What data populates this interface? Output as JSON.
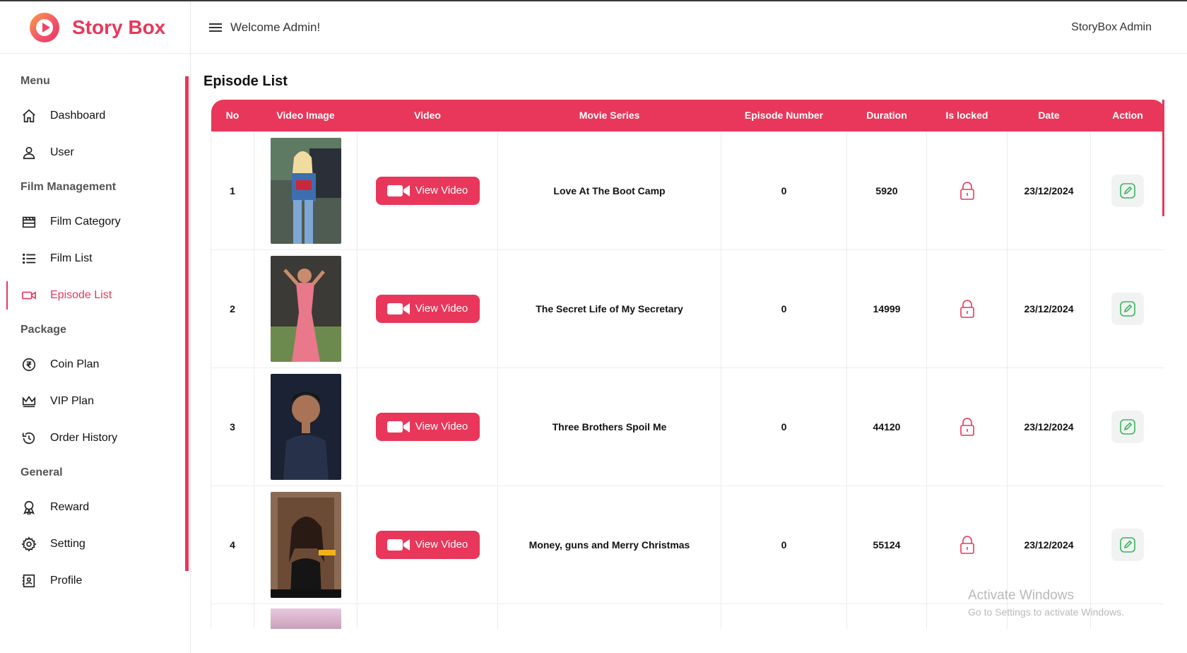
{
  "brand": {
    "name": "Story Box",
    "accent": "#e8375a"
  },
  "header": {
    "welcome": "Welcome Admin!",
    "user": "StoryBox Admin"
  },
  "sidebar": {
    "sections": [
      {
        "title": "Menu",
        "items": [
          {
            "label": "Dashboard",
            "icon": "home-icon"
          },
          {
            "label": "User",
            "icon": "user-icon"
          }
        ]
      },
      {
        "title": "Film Management",
        "items": [
          {
            "label": "Film Category",
            "icon": "clapperboard-icon"
          },
          {
            "label": "Film List",
            "icon": "list-icon"
          },
          {
            "label": "Episode List",
            "icon": "video-icon",
            "active": true
          }
        ]
      },
      {
        "title": "Package",
        "items": [
          {
            "label": "Coin Plan",
            "icon": "rupee-coin-icon"
          },
          {
            "label": "VIP Plan",
            "icon": "crown-icon"
          },
          {
            "label": "Order History",
            "icon": "history-icon"
          }
        ]
      },
      {
        "title": "General",
        "items": [
          {
            "label": "Reward",
            "icon": "award-icon"
          },
          {
            "label": "Setting",
            "icon": "gear-icon"
          },
          {
            "label": "Profile",
            "icon": "profile-icon"
          }
        ]
      }
    ]
  },
  "main": {
    "title": "Episode List",
    "columns": [
      "No",
      "Video Image",
      "Video",
      "Movie Series",
      "Episode Number",
      "Duration",
      "Is locked",
      "Date",
      "Action"
    ],
    "view_video_label": "View Video",
    "rows": [
      {
        "no": "1",
        "series": "Love At The Boot Camp",
        "episode": "0",
        "duration": "5920",
        "date": "23/12/2024"
      },
      {
        "no": "2",
        "series": "The Secret Life of My Secretary",
        "episode": "0",
        "duration": "14999",
        "date": "23/12/2024"
      },
      {
        "no": "3",
        "series": "Three Brothers Spoil Me",
        "episode": "0",
        "duration": "44120",
        "date": "23/12/2024"
      },
      {
        "no": "4",
        "series": "Money, guns and Merry Christmas",
        "episode": "0",
        "duration": "55124",
        "date": "23/12/2024"
      }
    ]
  },
  "watermark": {
    "line1": "Activate Windows",
    "line2": "Go to Settings to activate Windows."
  }
}
